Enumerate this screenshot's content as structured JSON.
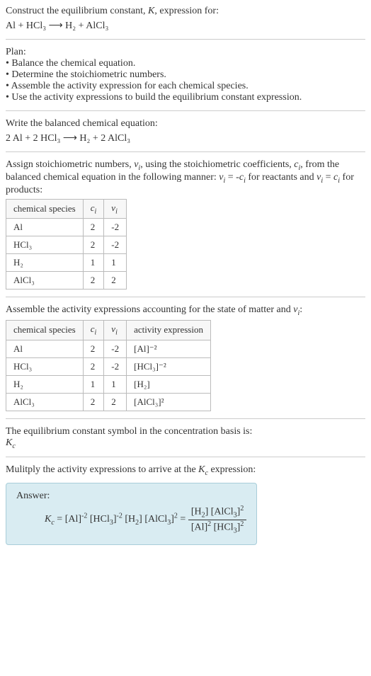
{
  "intro": {
    "line1": "Construct the equilibrium constant, K, expression for:",
    "equation": "Al + HCl₃  ⟶  H₂ + AlCl₃"
  },
  "plan": {
    "header": "Plan:",
    "bullet1": "• Balance the chemical equation.",
    "bullet2": "• Determine the stoichiometric numbers.",
    "bullet3": "• Assemble the activity expression for each chemical species.",
    "bullet4": "• Use the activity expressions to build the equilibrium constant expression."
  },
  "balanced": {
    "header": "Write the balanced chemical equation:",
    "equation": "2 Al + 2 HCl₃  ⟶  H₂ + 2 AlCl₃"
  },
  "assign": {
    "text": "Assign stoichiometric numbers, νᵢ, using the stoichiometric coefficients, cᵢ, from the balanced chemical equation in the following manner: νᵢ = -cᵢ for reactants and νᵢ = cᵢ for products:"
  },
  "table1": {
    "h1": "chemical species",
    "h2": "cᵢ",
    "h3": "νᵢ",
    "rows": [
      {
        "sp": "Al",
        "c": "2",
        "v": "-2"
      },
      {
        "sp": "HCl₃",
        "c": "2",
        "v": "-2"
      },
      {
        "sp": "H₂",
        "c": "1",
        "v": "1"
      },
      {
        "sp": "AlCl₃",
        "c": "2",
        "v": "2"
      }
    ]
  },
  "assemble": {
    "text": "Assemble the activity expressions accounting for the state of matter and νᵢ:"
  },
  "table2": {
    "h1": "chemical species",
    "h2": "cᵢ",
    "h3": "νᵢ",
    "h4": "activity expression",
    "rows": [
      {
        "sp": "Al",
        "c": "2",
        "v": "-2",
        "a": "[Al]⁻²"
      },
      {
        "sp": "HCl₃",
        "c": "2",
        "v": "-2",
        "a": "[HCl₃]⁻²"
      },
      {
        "sp": "H₂",
        "c": "1",
        "v": "1",
        "a": "[H₂]"
      },
      {
        "sp": "AlCl₃",
        "c": "2",
        "v": "2",
        "a": "[AlCl₃]²"
      }
    ]
  },
  "symbol": {
    "text": "The equilibrium constant symbol in the concentration basis is:",
    "sym": "K꜀"
  },
  "multiply": {
    "text": "Mulitply the activity expressions to arrive at the K꜀ expression:"
  },
  "answer": {
    "label": "Answer:",
    "lhs": "K꜀ = [Al]⁻² [HCl₃]⁻² [H₂] [AlCl₃]² = ",
    "num": "[H₂] [AlCl₃]²",
    "den": "[Al]² [HCl₃]²"
  }
}
